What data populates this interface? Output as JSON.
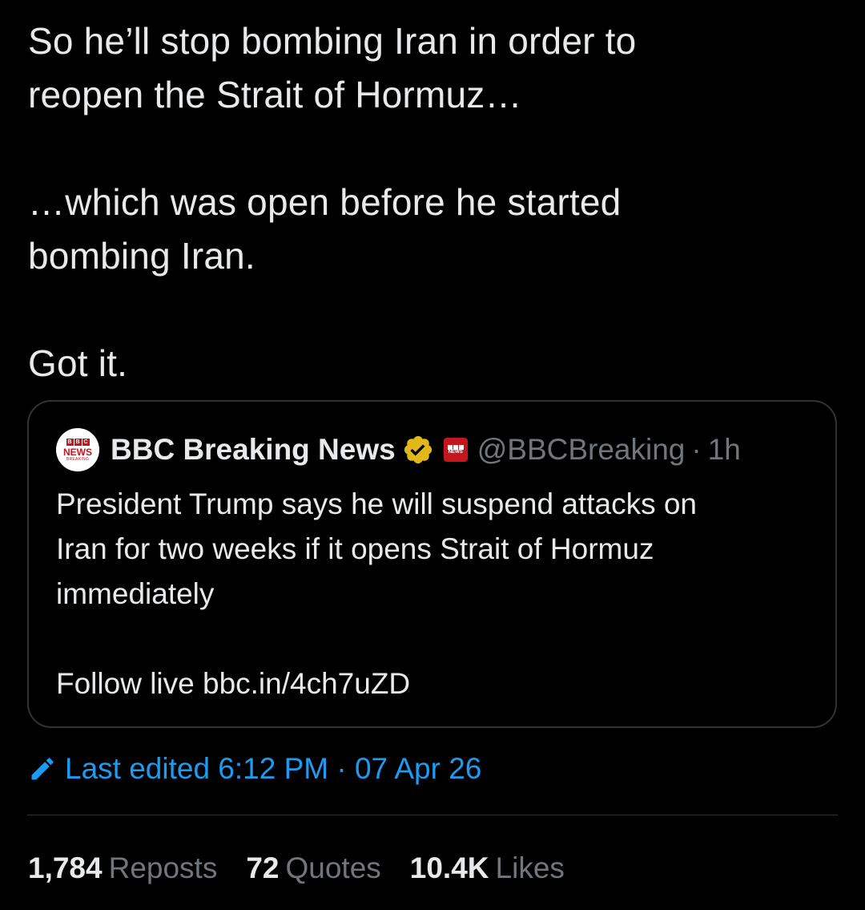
{
  "tweet": {
    "lines": [
      "So he’ll stop bombing Iran in order to",
      "reopen the Strait of Hormuz…",
      "…which was open before he started",
      "bombing Iran.",
      "Got it."
    ]
  },
  "quote": {
    "avatar": {
      "blocks": [
        "B",
        "B",
        "C"
      ],
      "news": "NEWS",
      "breaking": "BREAKING"
    },
    "name": "BBC Breaking News",
    "handle": "@BBCBreaking",
    "separator": "·",
    "time": "1h",
    "body_lines": [
      "President Trump says he will suspend attacks on",
      "Iran for two weeks if it opens Strait of Hormuz",
      "immediately",
      "Follow live bbc.in/4ch7uZD"
    ],
    "verified_color": "#e2b719",
    "brand_color": "#c4161c"
  },
  "edit": {
    "label": "Last edited 6:12 PM · 07 Apr 26",
    "icon": "pencil-icon",
    "color": "#1d9bf0"
  },
  "stats": {
    "reposts_count": "1,784",
    "reposts_label": "Reposts",
    "quotes_count": "72",
    "quotes_label": "Quotes",
    "likes_count": "10.4K",
    "likes_label": "Likes"
  }
}
